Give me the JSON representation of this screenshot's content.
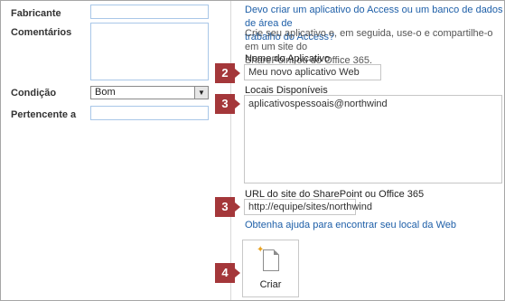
{
  "left_form": {
    "fabricante_label": "Fabricante",
    "comentarios_label": "Comentários",
    "condicao_label": "Condição",
    "condicao_value": "Bom",
    "pertencente_label": "Pertencente a"
  },
  "right_panel": {
    "access_question_link_line1": "Devo criar um aplicativo do Access ou um banco de dados de área de",
    "access_question_link_line2": "trabalho do Access?",
    "intro_line1": "Crie seu aplicativo e, em seguida, use-o e compartilhe-o em um site do",
    "intro_line2": "SharePoint ou do Office 365.",
    "app_name_label": "Nome do Aplicativo",
    "app_name_value": "Meu novo aplicativo Web",
    "locations_label": "Locais Disponíveis",
    "locations_items": [
      "aplicativospessoais@northwind"
    ],
    "site_url_label": "URL do site do SharePoint ou Office 365",
    "site_url_value": "http://equipe/sites/northwind",
    "help_link": "Obtenha ajuda para encontrar seu local da Web",
    "create_button_label": "Criar"
  },
  "callouts": {
    "app_name_step": "2",
    "locations_step": "3",
    "site_url_step": "3",
    "create_step": "4"
  },
  "colors": {
    "callout_bg": "#a4373a",
    "link": "#1e5fa8",
    "input_border": "#a9c7e8"
  },
  "icons": {
    "dropdown": "chevron-down-icon",
    "create": "new-document-icon"
  }
}
